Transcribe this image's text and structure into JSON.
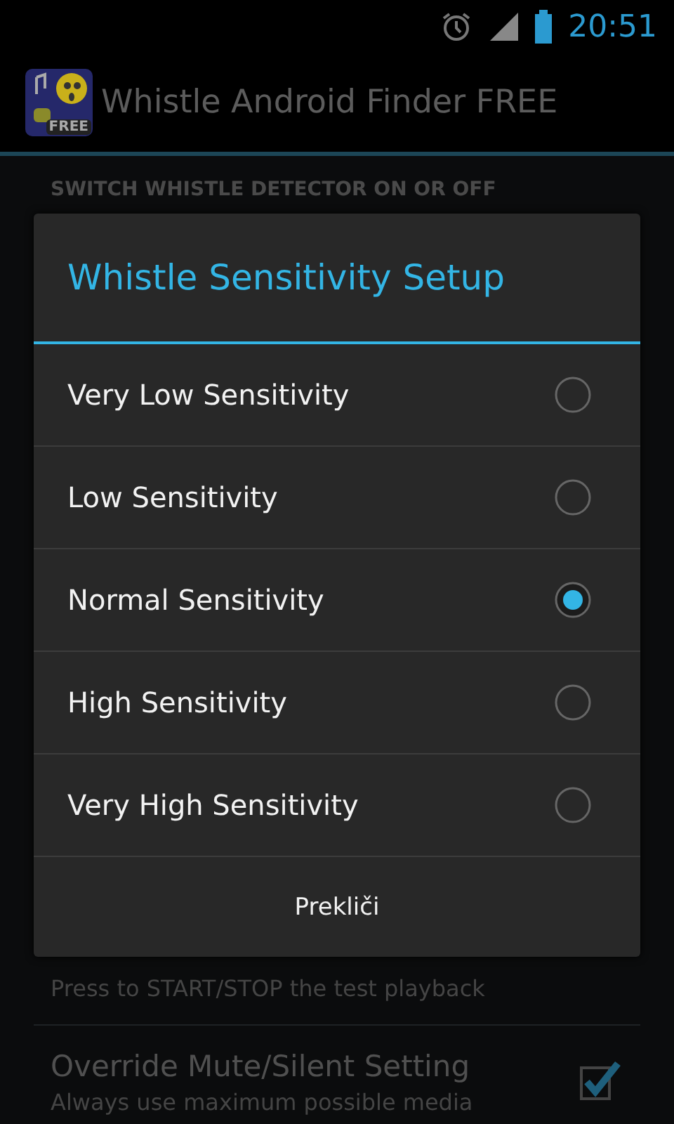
{
  "status_bar": {
    "time": "20:51"
  },
  "action_bar": {
    "title": "Whistle Android Finder FREE",
    "icon_badge": "FREE"
  },
  "settings": {
    "section_header": "SWITCH WHISTLE DETECTOR ON OR OFF",
    "items": [
      {
        "summary": "Press to START/STOP the test playback",
        "kind": "plain"
      },
      {
        "title": "Override Mute/Silent Setting",
        "summary": "Always use maximum possible media",
        "kind": "checkbox",
        "checked": true
      }
    ]
  },
  "dialog": {
    "title": "Whistle Sensitivity Setup",
    "options": [
      {
        "label": "Very Low Sensitivity",
        "selected": false
      },
      {
        "label": "Low Sensitivity",
        "selected": false
      },
      {
        "label": "Normal Sensitivity",
        "selected": true
      },
      {
        "label": "High Sensitivity",
        "selected": false
      },
      {
        "label": "Very High Sensitivity",
        "selected": false
      }
    ],
    "button": "Prekliči"
  }
}
